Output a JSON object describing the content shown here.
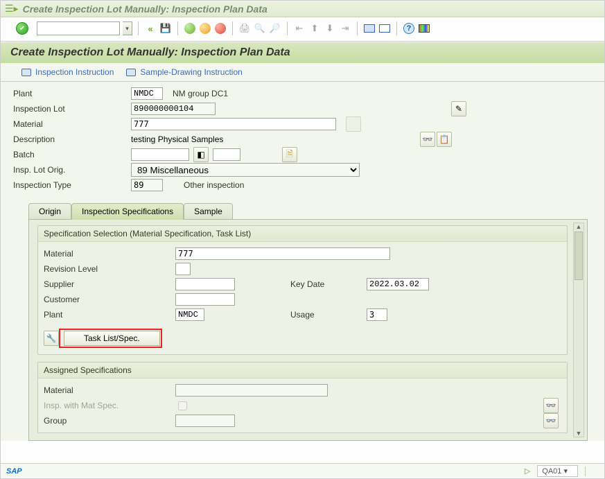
{
  "titlebar": {
    "title": "Create Inspection Lot Manually: Inspection Plan Data"
  },
  "page_header": "Create Inspection Lot Manually: Inspection Plan Data",
  "sub_toolbar": {
    "inspection_instruction": "Inspection Instruction",
    "sample_instruction": "Sample-Drawing Instruction"
  },
  "form": {
    "plant_label": "Plant",
    "plant_value": "NMDC",
    "plant_desc": "NM group DC1",
    "lot_label": "Inspection Lot",
    "lot_value": "890000000104",
    "material_label": "Material",
    "material_value": "777",
    "desc_label": "Description",
    "desc_value": "testing Physical Samples",
    "batch_label": "Batch",
    "orig_label": "Insp. Lot Orig.",
    "orig_value": "89 Miscellaneous",
    "type_label": "Inspection Type",
    "type_value": "89",
    "type_desc": "Other inspection"
  },
  "tabs": {
    "origin": "Origin",
    "spec": "Inspection Specifications",
    "sample": "Sample"
  },
  "spec_group_title": "Specification Selection (Material Specification, Task List)",
  "spec": {
    "material_label": "Material",
    "material_value": "777",
    "rev_label": "Revision Level",
    "supplier_label": "Supplier",
    "keydate_label": "Key Date",
    "keydate_value": "2022.03.02",
    "customer_label": "Customer",
    "plant_label": "Plant",
    "plant_value": "NMDC",
    "usage_label": "Usage",
    "usage_value": "3",
    "task_button": "Task List/Spec."
  },
  "assigned_title": "Assigned Specifications",
  "assigned": {
    "material_label": "Material",
    "insp_mat_label": "Insp. with Mat Spec.",
    "group_label": "Group"
  },
  "status": {
    "tcode": "QA01"
  }
}
